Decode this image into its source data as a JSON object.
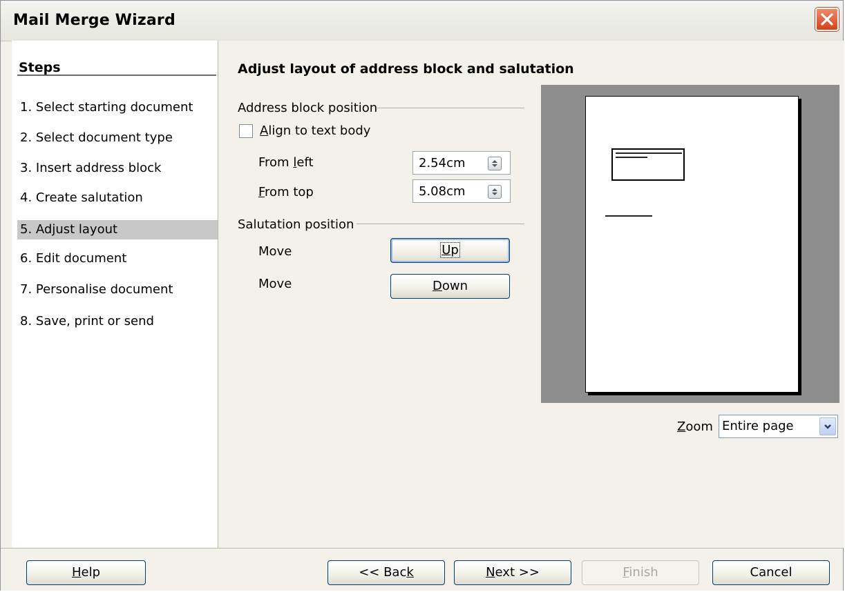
{
  "window": {
    "title": "Mail Merge Wizard"
  },
  "steps": {
    "title": "Steps",
    "items": [
      {
        "label": "1.  Select starting document",
        "active": false
      },
      {
        "label": "2.  Select document type",
        "active": false
      },
      {
        "label": "3.  Insert address block",
        "active": false
      },
      {
        "label": "4.  Create salutation",
        "active": false
      },
      {
        "label": "5.  Adjust layout",
        "active": true
      },
      {
        "label": "6.  Edit document",
        "active": false
      },
      {
        "label": "7.  Personalise document",
        "active": false
      },
      {
        "label": "8.  Save, print or send",
        "active": false
      }
    ]
  },
  "content": {
    "heading": "Adjust layout of address block and salutation",
    "address_block": {
      "group_label": "Address block position",
      "align_checkbox": {
        "label_mnemonic": "A",
        "label_rest": "lign to text body",
        "checked": false
      },
      "from_left": {
        "label_pre": "From ",
        "label_mnemonic": "l",
        "label_rest": "eft",
        "value": "2.54cm"
      },
      "from_top": {
        "label_mnemonic": "F",
        "label_rest": "rom top",
        "value": "5.08cm"
      }
    },
    "salutation": {
      "group_label": "Salutation position",
      "move_up_label": "Move",
      "move_down_label": "Move",
      "up_button": {
        "mnemonic": "U",
        "rest": "p"
      },
      "down_button": {
        "mnemonic": "D",
        "rest": "own"
      }
    },
    "zoom": {
      "label_mnemonic": "Z",
      "label_rest": "oom",
      "value": "Entire page"
    }
  },
  "footer": {
    "help": {
      "mnemonic": "H",
      "rest": "elp"
    },
    "back": {
      "pre": "<< Bac",
      "mnemonic": "k",
      "rest": ""
    },
    "next": {
      "mnemonic": "N",
      "rest": "ext >>"
    },
    "finish": {
      "mnemonic": "F",
      "rest": "inish",
      "enabled": false
    },
    "cancel": {
      "label": "Cancel"
    }
  }
}
